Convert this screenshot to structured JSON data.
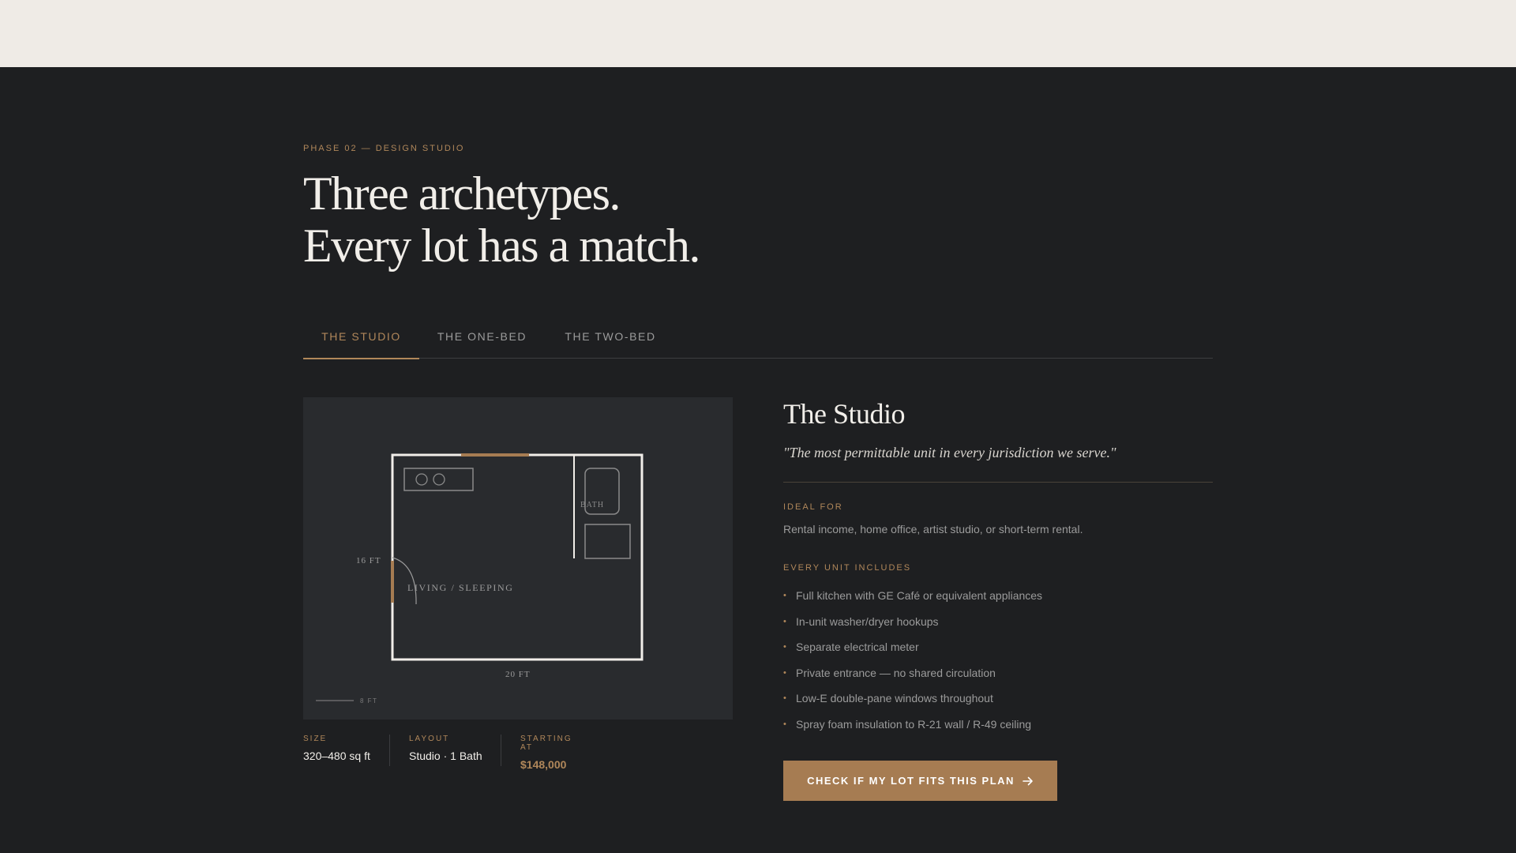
{
  "header": {
    "eyebrow": "PHASE 02 — DESIGN STUDIO",
    "headline_line1": "Three archetypes.",
    "headline_line2": "Every lot has a match."
  },
  "tabs": [
    {
      "label": "THE STUDIO",
      "active": true
    },
    {
      "label": "THE ONE-BED",
      "active": false
    },
    {
      "label": "THE TWO-BED",
      "active": false
    }
  ],
  "floorplan": {
    "dim_side": "16 FT",
    "dim_bottom": "20 FT",
    "room_main": "LIVING / SLEEPING",
    "room_bath": "BATH",
    "scale_label": "8 FT"
  },
  "specs": {
    "size_label": "SIZE",
    "size_value": "320–480 sq ft",
    "layout_label": "LAYOUT",
    "layout_value": "Studio · 1 Bath",
    "price_label": "STARTING AT",
    "price_value": "$148,000"
  },
  "detail": {
    "title": "The Studio",
    "quote": "\"The most permittable unit in every jurisdiction we serve.\"",
    "ideal_label": "IDEAL FOR",
    "ideal_text": "Rental income, home office, artist studio, or short-term rental.",
    "includes_label": "EVERY UNIT INCLUDES",
    "includes": [
      "Full kitchen with GE Café or equivalent appliances",
      "In-unit washer/dryer hookups",
      "Separate electrical meter",
      "Private entrance — no shared circulation",
      "Low-E double-pane windows throughout",
      "Spray foam insulation to R-21 wall / R-49 ceiling"
    ],
    "bullet": "•"
  },
  "cta": {
    "label": "CHECK IF MY LOT FITS THIS PLAN",
    "icon": "arrow-right-icon"
  },
  "colors": {
    "background": "#1e1f21",
    "topbar": "#efebe6",
    "accent": "#b0875a",
    "cta": "#a67c52",
    "panel": "#292b2e"
  }
}
